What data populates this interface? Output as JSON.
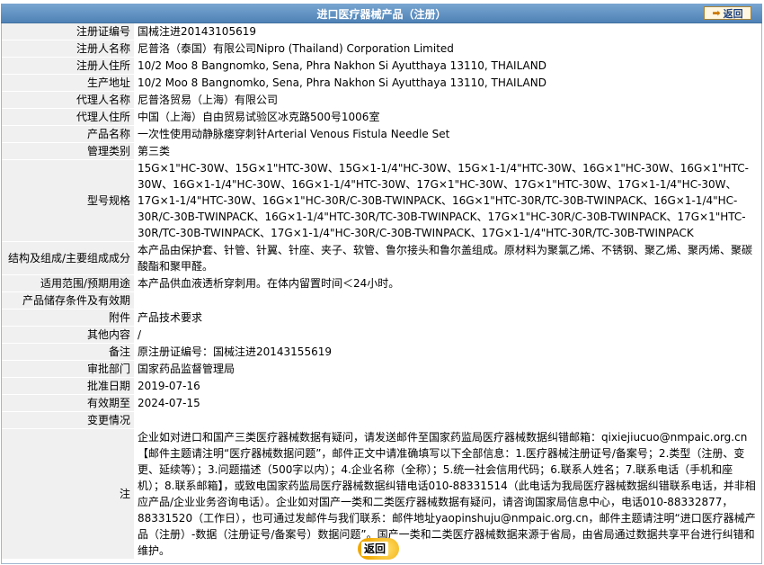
{
  "header": {
    "title": "进口医疗器械产品（注册）",
    "back_label": "返回"
  },
  "rows": [
    {
      "label": "注册证编号",
      "value": "国械注进20143105619"
    },
    {
      "label": "注册人名称",
      "value": "尼普洛（泰国）有限公司Nipro (Thailand) Corporation Limited"
    },
    {
      "label": "注册人住所",
      "value": "10/2 Moo 8 Bangnomko, Sena, Phra Nakhon Si Ayutthaya 13110, THAILAND"
    },
    {
      "label": "生产地址",
      "value": "10/2 Moo 8 Bangnomko, Sena, Phra Nakhon Si Ayutthaya 13110, THAILAND"
    },
    {
      "label": "代理人名称",
      "value": "尼普洛贸易（上海）有限公司"
    },
    {
      "label": "代理人住所",
      "value": "中国（上海）自由贸易试验区冰克路500号1006室"
    },
    {
      "label": "产品名称",
      "value": "一次性使用动静脉瘘穿刺针Arterial Venous Fistula Needle Set"
    },
    {
      "label": "管理类别",
      "value": "第三类"
    },
    {
      "label": "型号规格",
      "value": "15G×1\"HC-30W、15G×1\"HTC-30W、15G×1-1/4\"HC-30W、15G×1-1/4\"HTC-30W、16G×1\"HC-30W、16G×1\"HTC-30W、16G×1-1/4\"HC-30W、16G×1-1/4\"HTC-30W、17G×1\"HC-30W、17G×1\"HTC-30W、17G×1-1/4\"HC-30W、17G×1-1/4\"HTC-30W、16G×1\"HC-30R/C-30B-TWINPACK、16G×1\"HTC-30R/TC-30B-TWINPACK、16G×1-1/4\"HC-30R/C-30B-TWINPACK、16G×1-1/4\"HTC-30R/TC-30B-TWINPACK、17G×1\"HC-30R/C-30B-TWINPACK、17G×1\"HTC-30R/TC-30B-TWINPACK、17G×1-1/4\"HC-30R/C-30B-TWINPACK、17G×1-1/4\"HTC-30R/TC-30B-TWINPACK"
    },
    {
      "label": "结构及组成/主要组成成分",
      "value": "本产品由保护套、针管、针翼、针座、夹子、软管、鲁尔接头和鲁尔盖组成。原材料为聚氯乙烯、不锈钢、聚乙烯、聚丙烯、聚碳酸酯和聚甲醛。"
    },
    {
      "label": "适用范围/预期用途",
      "value": "本产品供血液透析穿刺用。在体内留置时间＜24小时。"
    },
    {
      "label": "产品储存条件及有效期",
      "value": ""
    },
    {
      "label": "附件",
      "value": "产品技术要求"
    },
    {
      "label": "其他内容",
      "value": "/"
    },
    {
      "label": "备注",
      "value": "原注册证编号：国械注进20143155619"
    },
    {
      "label": "审批部门",
      "value": "国家药品监督管理局"
    },
    {
      "label": "批准日期",
      "value": "2019-07-16"
    },
    {
      "label": "有效期至",
      "value": "2024-07-15"
    },
    {
      "label": "变更情况",
      "value": ""
    }
  ],
  "notice": {
    "label": "注",
    "text": "企业如对进口和国产三类医疗器械数据有疑问，请发送邮件至国家药监局医疗器械数据纠错邮箱：qixiejiucuo@nmpaic.org.cn【邮件主题请注明“医疗器械数据问题”，邮件正文中请准确填写以下全部信息：1.医疗器械注册证号/备案号；2.类型（注册、变更、延续等）；3.问题描述（500字以内）；4.企业名称（全称）；5.统一社会信用代码；6.联系人姓名；7.联系电话（手机和座机）；8.联系邮箱】，或致电国家药监局医疗器械数据纠错电话010-88331514（此电话为我局医疗器械数据纠错联系电话，并非相应产品/企业业务咨询电话）。企业如对国产一类和二类医疗器械数据有疑问，请咨询国家局信息中心，电话010-88332877，88331520（工作日），也可通过发邮件与我们联系：邮件地址yaopinshuju@nmpaic.org.cn，邮件主题请注明“进口医疗器械产品（注册）-数据（注册证号/备案号）数据问题”。国产一类和二类医疗器械数据来源于省局，由省局通过数据共享平台进行纠错和维护。"
  },
  "footer": {
    "back_label": "返回"
  },
  "colors": {
    "title_bar": "#5f8fbe",
    "label_bg": "#f0f0f0",
    "back_button": "#f0a900"
  }
}
